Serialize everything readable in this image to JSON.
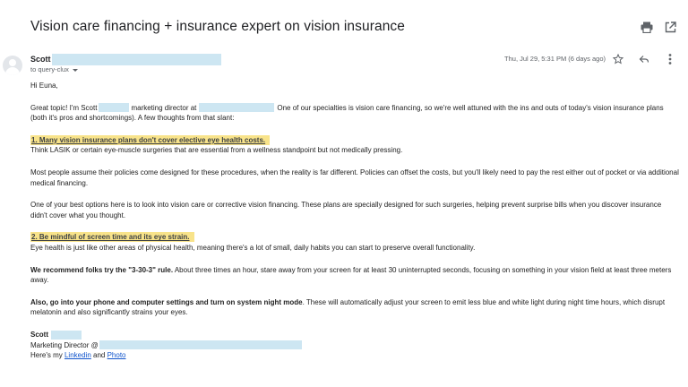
{
  "email": {
    "subject": "Vision care financing + insurance expert on vision insurance",
    "sender_name": "Scott",
    "sender_email_redacted": true,
    "to_label": "to query-clux",
    "timestamp": "Thu, Jul 29, 5:31 PM (6 days ago)",
    "greeting": "Hi Euna,",
    "intro_a": "Great topic! I'm Scott",
    "intro_b": "marketing director at",
    "intro_c": "One of our specialties is vision care financing, so we're well attuned with the ins and outs of today's vision insurance plans (both it's pros and shortcomings). A few thoughts from that slant:",
    "heading1": "1. Many vision insurance plans don't cover elective eye health costs.",
    "p1": "Think LASIK or certain eye-muscle surgeries that are essential from a wellness standpoint but not medically pressing.",
    "p2": "Most people assume their policies come designed for these procedures, when the reality is far different. Policies can offset the costs, but you'll likely need to pay the rest either out of pocket or via additional medical financing.",
    "p3": "One of your best options here is to look into vision care or corrective vision financing. These plans are specially designed for such surgeries, helping prevent surprise bills when you discover insurance didn't cover what you thought.",
    "heading2": "2. Be mindful of screen time and its eye strain.",
    "p4": "Eye health is just like other areas of physical health, meaning there's a lot of small, daily habits you can start to preserve overall functionality.",
    "p5_bold": "We recommend folks try the \"3-30-3\" rule.",
    "p5_rest": " About three times an hour, stare away from your screen for at least 30 uninterrupted seconds, focusing on something in your vision field at least three meters away.",
    "p6_bold": "Also, go into your phone and computer settings and turn on system night mode",
    "p6_rest": ". These will automatically adjust your screen to emit less blue and white light during night time hours, which disrupt melatonin and also significantly strains your eyes.",
    "sig_name": "Scott",
    "sig_title": "Marketing Director @",
    "sig_links_prefix": "Here's my ",
    "sig_link1": "Linkedin",
    "sig_and": " and ",
    "sig_link2": "Photo"
  },
  "icons": {
    "print": "print-icon",
    "open_new_window": "open-in-new-icon",
    "star": "star-icon",
    "reply": "reply-icon",
    "more": "more-vert-icon",
    "avatar": "avatar-icon"
  },
  "colors": {
    "highlight": "#f8e38a",
    "redaction": "#cde6f2",
    "link": "#1155cc"
  }
}
